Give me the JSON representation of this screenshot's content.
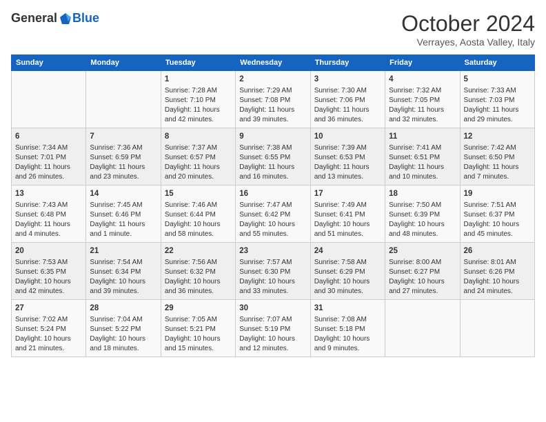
{
  "header": {
    "logo_general": "General",
    "logo_blue": "Blue",
    "title": "October 2024",
    "subtitle": "Verrayes, Aosta Valley, Italy"
  },
  "weekdays": [
    "Sunday",
    "Monday",
    "Tuesday",
    "Wednesday",
    "Thursday",
    "Friday",
    "Saturday"
  ],
  "weeks": [
    [
      {
        "day": "",
        "sunrise": "",
        "sunset": "",
        "daylight": ""
      },
      {
        "day": "",
        "sunrise": "",
        "sunset": "",
        "daylight": ""
      },
      {
        "day": "1",
        "sunrise": "Sunrise: 7:28 AM",
        "sunset": "Sunset: 7:10 PM",
        "daylight": "Daylight: 11 hours and 42 minutes."
      },
      {
        "day": "2",
        "sunrise": "Sunrise: 7:29 AM",
        "sunset": "Sunset: 7:08 PM",
        "daylight": "Daylight: 11 hours and 39 minutes."
      },
      {
        "day": "3",
        "sunrise": "Sunrise: 7:30 AM",
        "sunset": "Sunset: 7:06 PM",
        "daylight": "Daylight: 11 hours and 36 minutes."
      },
      {
        "day": "4",
        "sunrise": "Sunrise: 7:32 AM",
        "sunset": "Sunset: 7:05 PM",
        "daylight": "Daylight: 11 hours and 32 minutes."
      },
      {
        "day": "5",
        "sunrise": "Sunrise: 7:33 AM",
        "sunset": "Sunset: 7:03 PM",
        "daylight": "Daylight: 11 hours and 29 minutes."
      }
    ],
    [
      {
        "day": "6",
        "sunrise": "Sunrise: 7:34 AM",
        "sunset": "Sunset: 7:01 PM",
        "daylight": "Daylight: 11 hours and 26 minutes."
      },
      {
        "day": "7",
        "sunrise": "Sunrise: 7:36 AM",
        "sunset": "Sunset: 6:59 PM",
        "daylight": "Daylight: 11 hours and 23 minutes."
      },
      {
        "day": "8",
        "sunrise": "Sunrise: 7:37 AM",
        "sunset": "Sunset: 6:57 PM",
        "daylight": "Daylight: 11 hours and 20 minutes."
      },
      {
        "day": "9",
        "sunrise": "Sunrise: 7:38 AM",
        "sunset": "Sunset: 6:55 PM",
        "daylight": "Daylight: 11 hours and 16 minutes."
      },
      {
        "day": "10",
        "sunrise": "Sunrise: 7:39 AM",
        "sunset": "Sunset: 6:53 PM",
        "daylight": "Daylight: 11 hours and 13 minutes."
      },
      {
        "day": "11",
        "sunrise": "Sunrise: 7:41 AM",
        "sunset": "Sunset: 6:51 PM",
        "daylight": "Daylight: 11 hours and 10 minutes."
      },
      {
        "day": "12",
        "sunrise": "Sunrise: 7:42 AM",
        "sunset": "Sunset: 6:50 PM",
        "daylight": "Daylight: 11 hours and 7 minutes."
      }
    ],
    [
      {
        "day": "13",
        "sunrise": "Sunrise: 7:43 AM",
        "sunset": "Sunset: 6:48 PM",
        "daylight": "Daylight: 11 hours and 4 minutes."
      },
      {
        "day": "14",
        "sunrise": "Sunrise: 7:45 AM",
        "sunset": "Sunset: 6:46 PM",
        "daylight": "Daylight: 11 hours and 1 minute."
      },
      {
        "day": "15",
        "sunrise": "Sunrise: 7:46 AM",
        "sunset": "Sunset: 6:44 PM",
        "daylight": "Daylight: 10 hours and 58 minutes."
      },
      {
        "day": "16",
        "sunrise": "Sunrise: 7:47 AM",
        "sunset": "Sunset: 6:42 PM",
        "daylight": "Daylight: 10 hours and 55 minutes."
      },
      {
        "day": "17",
        "sunrise": "Sunrise: 7:49 AM",
        "sunset": "Sunset: 6:41 PM",
        "daylight": "Daylight: 10 hours and 51 minutes."
      },
      {
        "day": "18",
        "sunrise": "Sunrise: 7:50 AM",
        "sunset": "Sunset: 6:39 PM",
        "daylight": "Daylight: 10 hours and 48 minutes."
      },
      {
        "day": "19",
        "sunrise": "Sunrise: 7:51 AM",
        "sunset": "Sunset: 6:37 PM",
        "daylight": "Daylight: 10 hours and 45 minutes."
      }
    ],
    [
      {
        "day": "20",
        "sunrise": "Sunrise: 7:53 AM",
        "sunset": "Sunset: 6:35 PM",
        "daylight": "Daylight: 10 hours and 42 minutes."
      },
      {
        "day": "21",
        "sunrise": "Sunrise: 7:54 AM",
        "sunset": "Sunset: 6:34 PM",
        "daylight": "Daylight: 10 hours and 39 minutes."
      },
      {
        "day": "22",
        "sunrise": "Sunrise: 7:56 AM",
        "sunset": "Sunset: 6:32 PM",
        "daylight": "Daylight: 10 hours and 36 minutes."
      },
      {
        "day": "23",
        "sunrise": "Sunrise: 7:57 AM",
        "sunset": "Sunset: 6:30 PM",
        "daylight": "Daylight: 10 hours and 33 minutes."
      },
      {
        "day": "24",
        "sunrise": "Sunrise: 7:58 AM",
        "sunset": "Sunset: 6:29 PM",
        "daylight": "Daylight: 10 hours and 30 minutes."
      },
      {
        "day": "25",
        "sunrise": "Sunrise: 8:00 AM",
        "sunset": "Sunset: 6:27 PM",
        "daylight": "Daylight: 10 hours and 27 minutes."
      },
      {
        "day": "26",
        "sunrise": "Sunrise: 8:01 AM",
        "sunset": "Sunset: 6:26 PM",
        "daylight": "Daylight: 10 hours and 24 minutes."
      }
    ],
    [
      {
        "day": "27",
        "sunrise": "Sunrise: 7:02 AM",
        "sunset": "Sunset: 5:24 PM",
        "daylight": "Daylight: 10 hours and 21 minutes."
      },
      {
        "day": "28",
        "sunrise": "Sunrise: 7:04 AM",
        "sunset": "Sunset: 5:22 PM",
        "daylight": "Daylight: 10 hours and 18 minutes."
      },
      {
        "day": "29",
        "sunrise": "Sunrise: 7:05 AM",
        "sunset": "Sunset: 5:21 PM",
        "daylight": "Daylight: 10 hours and 15 minutes."
      },
      {
        "day": "30",
        "sunrise": "Sunrise: 7:07 AM",
        "sunset": "Sunset: 5:19 PM",
        "daylight": "Daylight: 10 hours and 12 minutes."
      },
      {
        "day": "31",
        "sunrise": "Sunrise: 7:08 AM",
        "sunset": "Sunset: 5:18 PM",
        "daylight": "Daylight: 10 hours and 9 minutes."
      },
      {
        "day": "",
        "sunrise": "",
        "sunset": "",
        "daylight": ""
      },
      {
        "day": "",
        "sunrise": "",
        "sunset": "",
        "daylight": ""
      }
    ]
  ]
}
